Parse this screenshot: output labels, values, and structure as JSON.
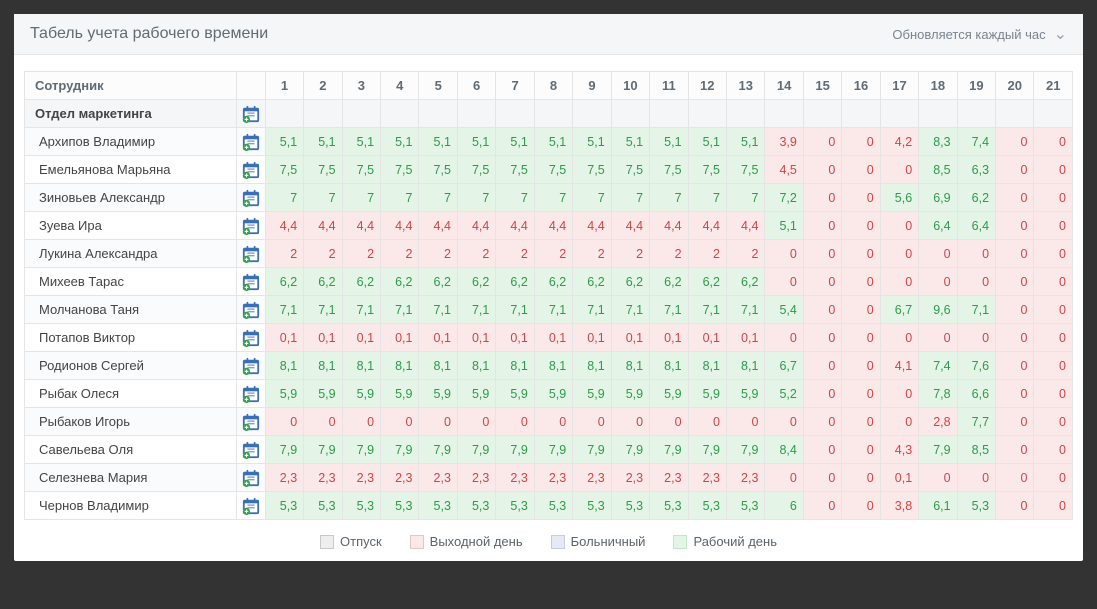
{
  "panel": {
    "title": "Табель учета рабочего времени",
    "update_info": "Обновляется каждый час"
  },
  "columns": {
    "employee": "Сотрудник",
    "days": [
      1,
      2,
      3,
      4,
      5,
      6,
      7,
      8,
      9,
      10,
      11,
      12,
      13,
      14,
      15,
      16,
      17,
      18,
      19,
      20,
      21
    ]
  },
  "special_days": {
    "weekend": [
      15,
      16,
      20,
      21
    ],
    "vacation": [],
    "sick": []
  },
  "department": {
    "name": "Отдел маркетинга"
  },
  "employees": [
    {
      "name": "Архипов Владимир",
      "v": [
        "5,1",
        "5,1",
        "5,1",
        "5,1",
        "5,1",
        "5,1",
        "5,1",
        "5,1",
        "5,1",
        "5,1",
        "5,1",
        "5,1",
        "5,1",
        "3,9",
        "0",
        "0",
        "4,2",
        "8,3",
        "7,4",
        "0",
        "0"
      ]
    },
    {
      "name": "Емельянова Марьяна",
      "v": [
        "7,5",
        "7,5",
        "7,5",
        "7,5",
        "7,5",
        "7,5",
        "7,5",
        "7,5",
        "7,5",
        "7,5",
        "7,5",
        "7,5",
        "7,5",
        "4,5",
        "0",
        "0",
        "0",
        "8,5",
        "6,3",
        "0",
        "0"
      ]
    },
    {
      "name": "Зиновьев Александр",
      "v": [
        "7",
        "7",
        "7",
        "7",
        "7",
        "7",
        "7",
        "7",
        "7",
        "7",
        "7",
        "7",
        "7",
        "7,2",
        "0",
        "0",
        "5,6",
        "6,9",
        "6,2",
        "0",
        "0"
      ]
    },
    {
      "name": "Зуева Ира",
      "v": [
        "4,4",
        "4,4",
        "4,4",
        "4,4",
        "4,4",
        "4,4",
        "4,4",
        "4,4",
        "4,4",
        "4,4",
        "4,4",
        "4,4",
        "4,4",
        "5,1",
        "0",
        "0",
        "0",
        "6,4",
        "6,4",
        "0",
        "0"
      ]
    },
    {
      "name": "Лукина Александра",
      "v": [
        "2",
        "2",
        "2",
        "2",
        "2",
        "2",
        "2",
        "2",
        "2",
        "2",
        "2",
        "2",
        "2",
        "0",
        "0",
        "0",
        "0",
        "0",
        "0",
        "0",
        "0"
      ]
    },
    {
      "name": "Михеев Тарас",
      "v": [
        "6,2",
        "6,2",
        "6,2",
        "6,2",
        "6,2",
        "6,2",
        "6,2",
        "6,2",
        "6,2",
        "6,2",
        "6,2",
        "6,2",
        "6,2",
        "0",
        "0",
        "0",
        "0",
        "0",
        "0",
        "0",
        "0"
      ]
    },
    {
      "name": "Молчанова Таня",
      "v": [
        "7,1",
        "7,1",
        "7,1",
        "7,1",
        "7,1",
        "7,1",
        "7,1",
        "7,1",
        "7,1",
        "7,1",
        "7,1",
        "7,1",
        "7,1",
        "5,4",
        "0",
        "0",
        "6,7",
        "9,6",
        "7,1",
        "0",
        "0"
      ]
    },
    {
      "name": "Потапов Виктор",
      "v": [
        "0,1",
        "0,1",
        "0,1",
        "0,1",
        "0,1",
        "0,1",
        "0,1",
        "0,1",
        "0,1",
        "0,1",
        "0,1",
        "0,1",
        "0,1",
        "0",
        "0",
        "0",
        "0",
        "0",
        "0",
        "0",
        "0"
      ]
    },
    {
      "name": "Родионов Сергей",
      "v": [
        "8,1",
        "8,1",
        "8,1",
        "8,1",
        "8,1",
        "8,1",
        "8,1",
        "8,1",
        "8,1",
        "8,1",
        "8,1",
        "8,1",
        "8,1",
        "6,7",
        "0",
        "0",
        "4,1",
        "7,4",
        "7,6",
        "0",
        "0"
      ]
    },
    {
      "name": "Рыбак Олеся",
      "v": [
        "5,9",
        "5,9",
        "5,9",
        "5,9",
        "5,9",
        "5,9",
        "5,9",
        "5,9",
        "5,9",
        "5,9",
        "5,9",
        "5,9",
        "5,9",
        "5,2",
        "0",
        "0",
        "0",
        "7,8",
        "6,6",
        "0",
        "0"
      ]
    },
    {
      "name": "Рыбаков Игорь",
      "v": [
        "0",
        "0",
        "0",
        "0",
        "0",
        "0",
        "0",
        "0",
        "0",
        "0",
        "0",
        "0",
        "0",
        "0",
        "0",
        "0",
        "0",
        "2,8",
        "7,7",
        "0",
        "0"
      ]
    },
    {
      "name": "Савельева Оля",
      "v": [
        "7,9",
        "7,9",
        "7,9",
        "7,9",
        "7,9",
        "7,9",
        "7,9",
        "7,9",
        "7,9",
        "7,9",
        "7,9",
        "7,9",
        "7,9",
        "8,4",
        "0",
        "0",
        "4,3",
        "7,9",
        "8,5",
        "0",
        "0"
      ]
    },
    {
      "name": "Селезнева Мария",
      "v": [
        "2,3",
        "2,3",
        "2,3",
        "2,3",
        "2,3",
        "2,3",
        "2,3",
        "2,3",
        "2,3",
        "2,3",
        "2,3",
        "2,3",
        "2,3",
        "0",
        "0",
        "0",
        "0,1",
        "0",
        "0",
        "0",
        "0"
      ]
    },
    {
      "name": "Чернов Владимир",
      "v": [
        "5,3",
        "5,3",
        "5,3",
        "5,3",
        "5,3",
        "5,3",
        "5,3",
        "5,3",
        "5,3",
        "5,3",
        "5,3",
        "5,3",
        "5,3",
        "6",
        "0",
        "0",
        "3,8",
        "6,1",
        "5,3",
        "0",
        "0"
      ]
    }
  ],
  "legend": {
    "vacation": "Отпуск",
    "weekend": "Выходной день",
    "sick": "Больничный",
    "work": "Рабочий день"
  },
  "colors": {
    "work_bg": "#e4f4e6",
    "work_fg": "#2e9b4a",
    "off_bg": "#fbe9e9",
    "off_fg": "#d04545"
  }
}
